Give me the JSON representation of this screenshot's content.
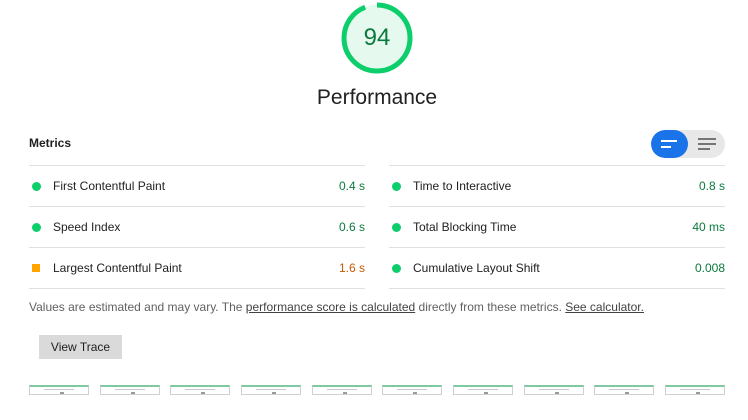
{
  "score": {
    "value": "94",
    "fraction": 0.94,
    "ring_color": "#0cce6b",
    "fill_color": "#e6f9ee",
    "text_color": "#0c7a3e"
  },
  "category_title": "Performance",
  "metrics": {
    "header": "Metrics",
    "toggle": {
      "selected": "summary-view",
      "accent": "#1a73e8",
      "icons": [
        "summary-view-icon",
        "expanded-view-icon"
      ]
    },
    "left": [
      {
        "label": "First Contentful Paint",
        "value": "0.4 s",
        "rating": "pass"
      },
      {
        "label": "Speed Index",
        "value": "0.6 s",
        "rating": "pass"
      },
      {
        "label": "Largest Contentful Paint",
        "value": "1.6 s",
        "rating": "average"
      }
    ],
    "right": [
      {
        "label": "Time to Interactive",
        "value": "0.8 s",
        "rating": "pass"
      },
      {
        "label": "Total Blocking Time",
        "value": "40 ms",
        "rating": "pass"
      },
      {
        "label": "Cumulative Layout Shift",
        "value": "0.008",
        "rating": "pass"
      }
    ]
  },
  "note": {
    "prefix": "Values are estimated and may vary. The ",
    "link1": "performance score is calculated",
    "middle": " directly from these metrics. ",
    "link2": "See calculator."
  },
  "view_trace_label": "View Trace",
  "filmstrip": {
    "frame_count": 10
  }
}
